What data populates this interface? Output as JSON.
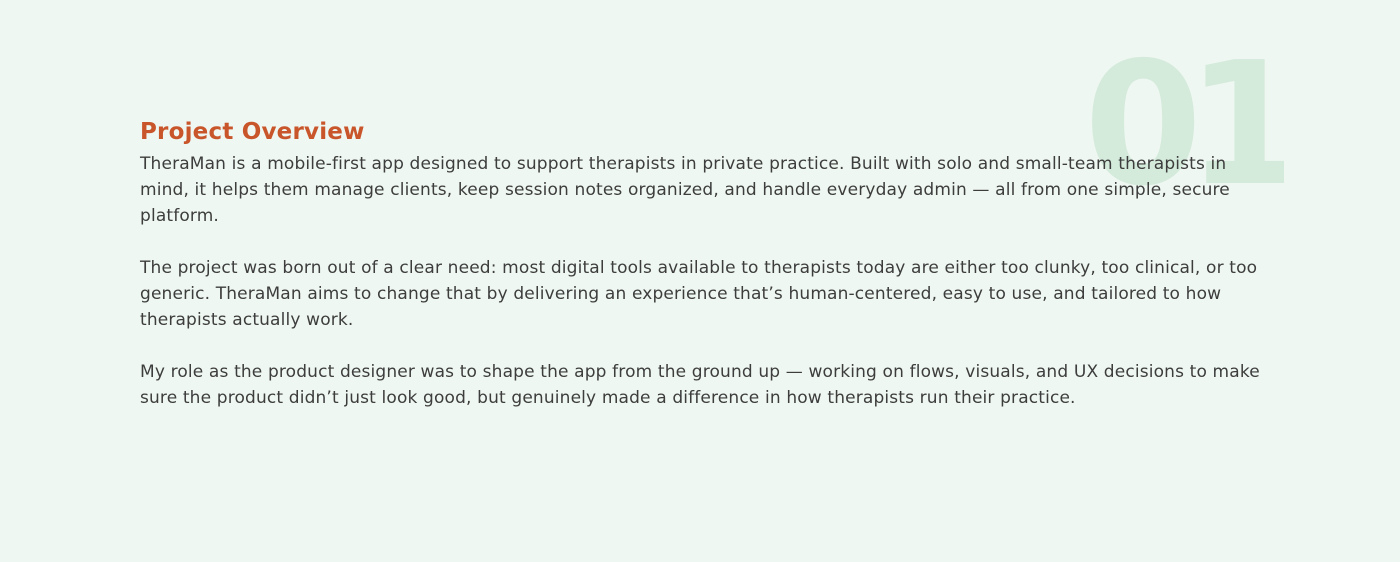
{
  "section": {
    "number": "01",
    "title": "Project Overview",
    "paragraphs": [
      "TheraMan is a mobile-first app designed to support therapists in private practice. Built with solo and small-team therapists in mind, it helps them manage clients, keep session notes organized, and handle everyday admin — all from one simple, secure platform.",
      "The project was born out of a clear need: most digital tools available to therapists today are either too clunky, too clinical, or too generic. TheraMan aims to change that by delivering an experience that’s human-centered, easy to use, and tailored to how therapists actually work.",
      "My role as the product designer was to shape the app from the ground up — working on flows, visuals, and UX decisions to make sure the product didn’t just look good, but genuinely made a difference in how therapists run their practice."
    ]
  },
  "colors": {
    "background": "#eef7f1",
    "accent": "#c9552b",
    "number": "#d4eadb",
    "text": "#3d3d3d"
  }
}
